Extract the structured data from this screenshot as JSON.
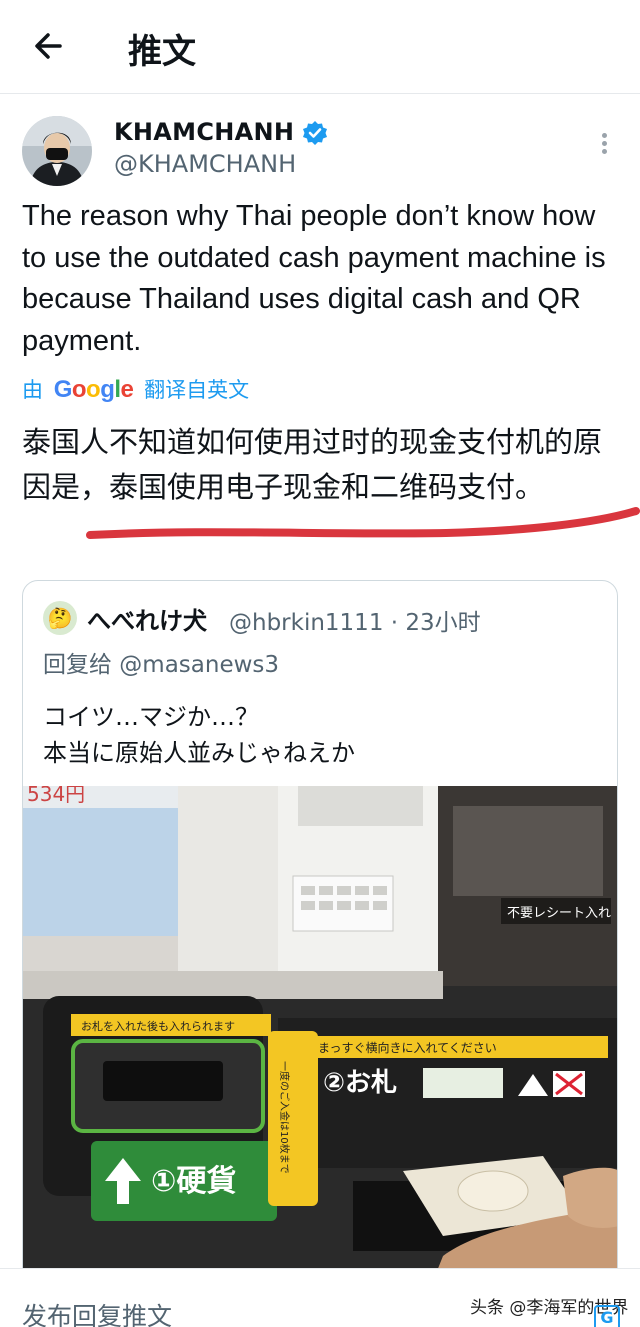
{
  "header": {
    "title": "推文"
  },
  "tweet": {
    "display_name": "KHAMCHANH",
    "handle": "@KHAMCHANH",
    "text": "The reason why Thai people don’t know how to use the outdated cash payment machine is because Thailand uses digital cash and QR payment.",
    "translation": {
      "prefix": "由",
      "provider": "Google",
      "suffix": "翻译自英文",
      "text": "泰国人不知道如何使用过时的现金支付机的原因是，泰国使用电子现金和二维码支付。"
    }
  },
  "quote": {
    "display_name": "へべれけ犬",
    "handle_time": "@hbrkin1111 · 23小时",
    "reply_to": "回复给 @masanews3",
    "text_line1": "コイツ…マジか…？",
    "text_line2": "本当に原始人並みじゃねえか",
    "photo": {
      "price_fragment": "534円",
      "receipt_sign": "不要レシート入れ",
      "coin_slot_label": "①硬貨",
      "coin_slot_notice": "お札を入れた後も入れられます",
      "bill_slot_label": "②お札",
      "bill_slot_notice": "まっすぐ横向きに入れてください",
      "bill_limit": "一度のご入金は10枚まで"
    }
  },
  "bottom": {
    "reply_placeholder": "发布回复推文",
    "watermark": "头条 @李海军的世界",
    "watermark_badge": "G"
  },
  "colors": {
    "accent": "#1d9bf0",
    "underline": "#d9363e"
  }
}
